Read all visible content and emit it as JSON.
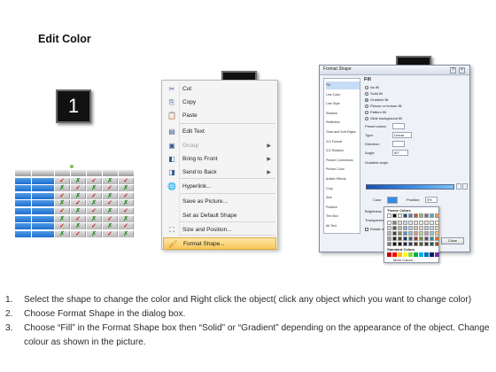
{
  "title": "Edit Color",
  "steps": [
    "1",
    "2",
    "3"
  ],
  "table": {
    "header": [
      "",
      "",
      "",
      "",
      "",
      "",
      ""
    ],
    "rows": [
      [
        "",
        "",
        "✓",
        "✗",
        "✓",
        "✗",
        "✓"
      ],
      [
        "",
        "",
        "✗",
        "✓",
        "✗",
        "✓",
        "✗"
      ],
      [
        "",
        "",
        "✓",
        "✗",
        "✓",
        "✗",
        "✓"
      ],
      [
        "",
        "",
        "✗",
        "✓",
        "✗",
        "✓",
        "✗"
      ],
      [
        "",
        "",
        "✓",
        "✗",
        "✓",
        "✗",
        "✓"
      ],
      [
        "",
        "",
        "✗",
        "✓",
        "✗",
        "✓",
        "✗"
      ],
      [
        "",
        "",
        "✓",
        "✗",
        "✓",
        "✗",
        "✓"
      ],
      [
        "",
        "",
        "✗",
        "✓",
        "✗",
        "✓",
        "✗"
      ]
    ]
  },
  "context_menu": {
    "items": [
      {
        "label": "Cut",
        "icon": "✂",
        "icon_name": "scissors-icon"
      },
      {
        "label": "Copy",
        "icon": "⎘",
        "icon_name": "copy-icon"
      },
      {
        "label": "Paste",
        "icon": "📋",
        "icon_name": "paste-icon"
      },
      {
        "label": "Edit Text",
        "icon": "▤",
        "icon_name": "edit-text-icon"
      },
      {
        "label": "Group",
        "icon": "▣",
        "icon_name": "group-icon",
        "disabled": true,
        "submenu": true
      },
      {
        "label": "Bring to Front",
        "icon": "◧",
        "icon_name": "bring-front-icon",
        "submenu": true
      },
      {
        "label": "Send to Back",
        "icon": "◨",
        "icon_name": "send-back-icon",
        "submenu": true
      },
      {
        "label": "Hyperlink...",
        "icon": "🌐",
        "icon_name": "hyperlink-icon"
      },
      {
        "label": "Save as Picture...",
        "icon": "",
        "icon_name": ""
      },
      {
        "label": "Set as Default Shape",
        "icon": "",
        "icon_name": ""
      },
      {
        "label": "Size and Position...",
        "icon": "⛶",
        "icon_name": "size-position-icon"
      },
      {
        "label": "Format Shape...",
        "icon": "🖌",
        "icon_name": "format-shape-icon",
        "highlighted": true
      }
    ]
  },
  "dialog": {
    "title": "Format Shape",
    "sidebar": [
      "Fill",
      "Line Color",
      "Line Style",
      "Shadow",
      "Reflection",
      "Glow and Soft Edges",
      "3-D Format",
      "3-D Rotation",
      "Picture Corrections",
      "Picture Color",
      "Artistic Effects",
      "Crop",
      "Size",
      "Position",
      "Text Box",
      "Alt Text"
    ],
    "fill_heading": "Fill",
    "fill_options": [
      "No fill",
      "Solid fill",
      "Gradient fill",
      "Picture or texture fill",
      "Pattern fill",
      "Slide background fill"
    ],
    "selected_fill": "Gradient fill",
    "preset_label": "Preset colors:",
    "type_label": "Type:",
    "type_value": "Linear",
    "direction_label": "Direction:",
    "angle_label": "Angle:",
    "angle_value": "90°",
    "stops_label": "Gradient stops",
    "color_label": "Color",
    "position_label": "Position:",
    "position_value": "0%",
    "brightness_label": "Brightness",
    "transparency_label": "Transparency:",
    "rotate_label": "Rotate with shape",
    "close_label": "Close",
    "theme_colors_label": "Theme Colors",
    "standard_colors_label": "Standard Colors",
    "more_colors_label": "More Colors..."
  },
  "instructions": [
    {
      "num": "1.",
      "text": "Select the shape to change the color and Right click the object( click any object which you want to change color)"
    },
    {
      "num": "2.",
      "text": "Choose Format Shape in the dialog box."
    },
    {
      "num": "3.",
      "text": "Choose “Fill” in the Format Shape box then “Solid” or “Gradient” depending on the appearance of the object. Change colour as shown in the picture."
    }
  ],
  "colors": {
    "table_blue": "#1f6fcf",
    "menu_highlight": "#f8c65c",
    "badge": "#111111"
  }
}
